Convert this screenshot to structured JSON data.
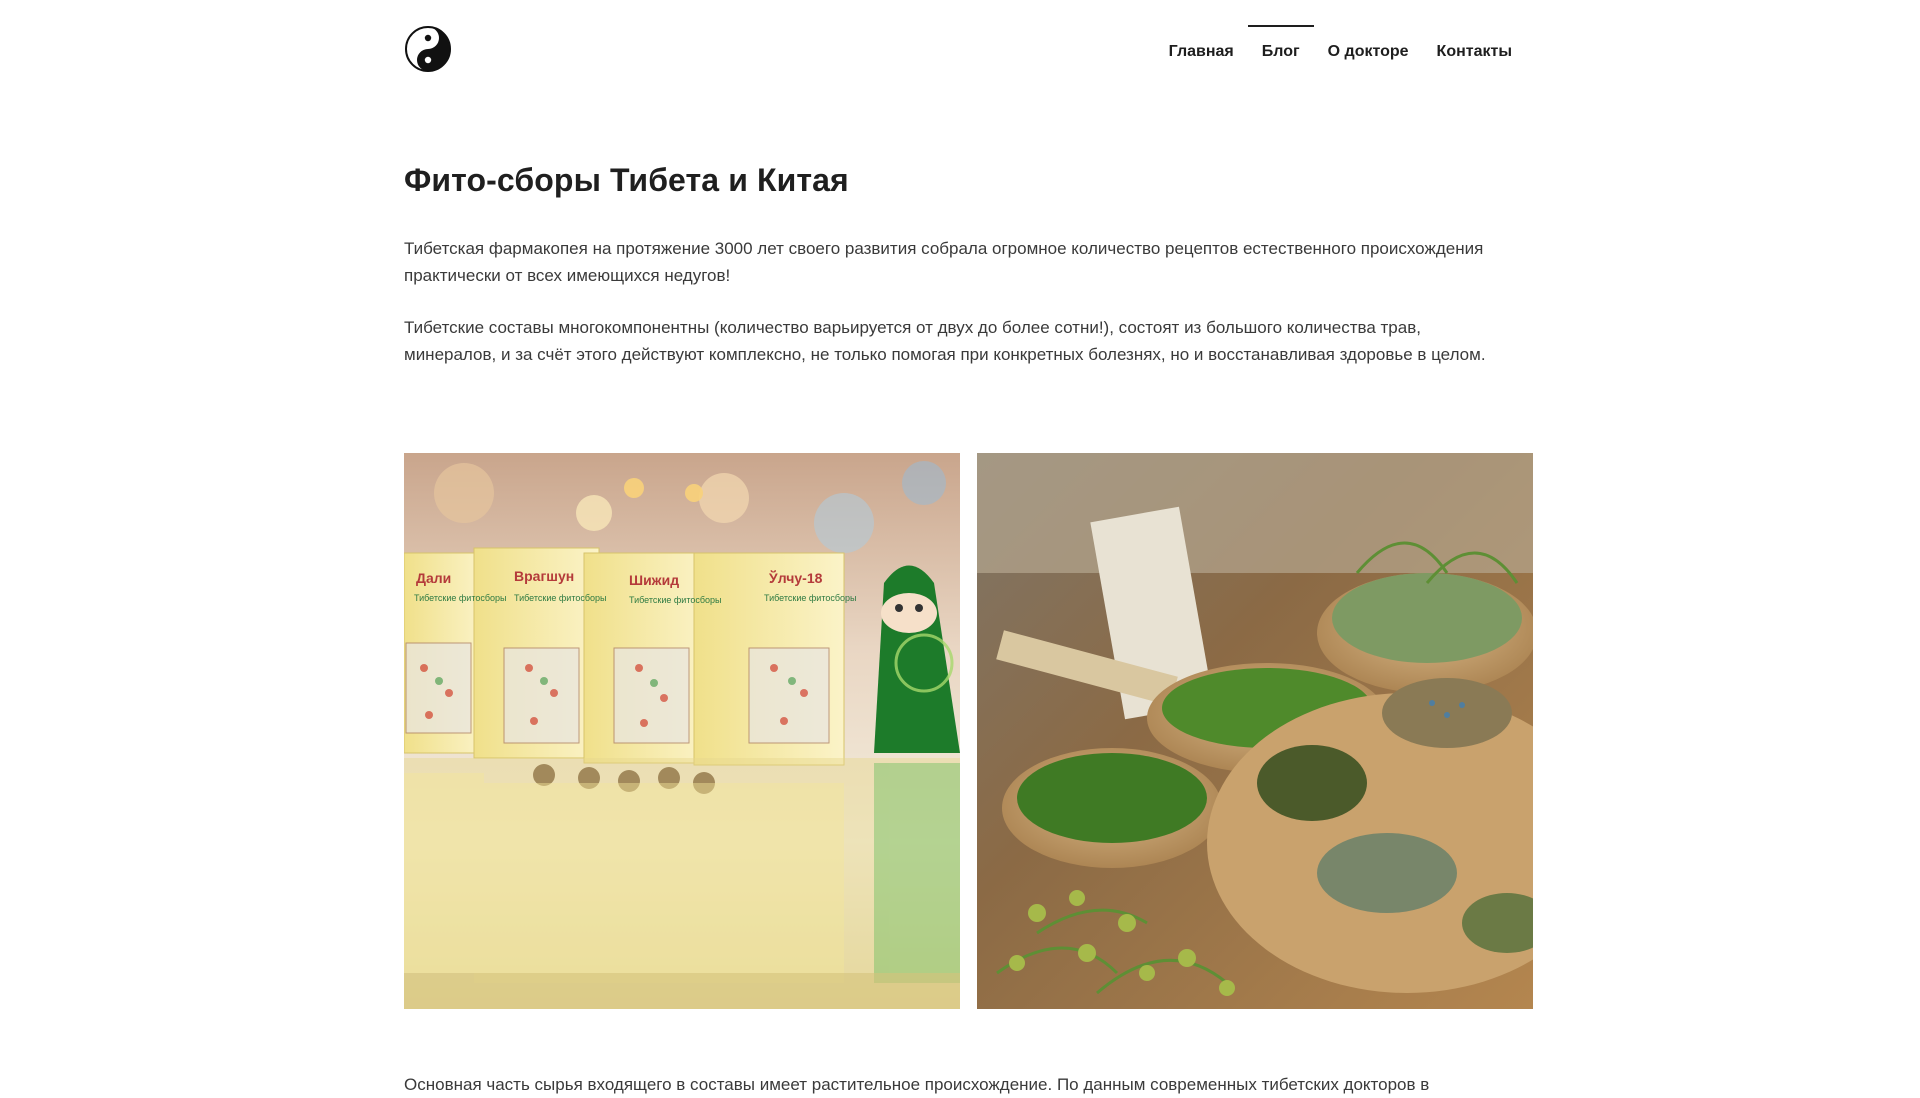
{
  "header": {
    "logo_icon": "yin-yang-icon",
    "nav": [
      {
        "label": "Главная",
        "active": false
      },
      {
        "label": "Блог",
        "active": true
      },
      {
        "label": "О докторе",
        "active": false
      },
      {
        "label": "Контакты",
        "active": false
      }
    ]
  },
  "article": {
    "title": "Фито-сборы Тибета и Китая",
    "paragraphs": [
      "Тибетская фармакопея на протяжение 3000 лет своего развития собрала огромное количество рецептов естественного происхождения практически от всех имеющихся недугов!",
      "Тибетские составы многокомпонентны (количество варьируется от двух до более сотни!), состоят из большого количества трав, минералов, и за счёт этого действуют комплексно, не только помогая при конкретных болезнях, но и восстанавливая здоровье в целом.",
      "Основная часть сырья входящего в составы имеет растительное происхождение. По данным современных тибетских докторов в"
    ],
    "images": [
      {
        "name": "tibetan-tea-boxes-photo",
        "box_labels": [
          "Дали",
          "Врагшун",
          "Шижид",
          "Ўлчу-18"
        ],
        "box_subtitle": "Тибетские фитосборы"
      },
      {
        "name": "herbs-in-bowls-photo"
      }
    ]
  },
  "colors": {
    "text": "#2b2b2b",
    "background": "#ffffff",
    "box_yellow": "#f3e79a",
    "herb_green": "#4f8a2b",
    "wood": "#b4864f"
  }
}
